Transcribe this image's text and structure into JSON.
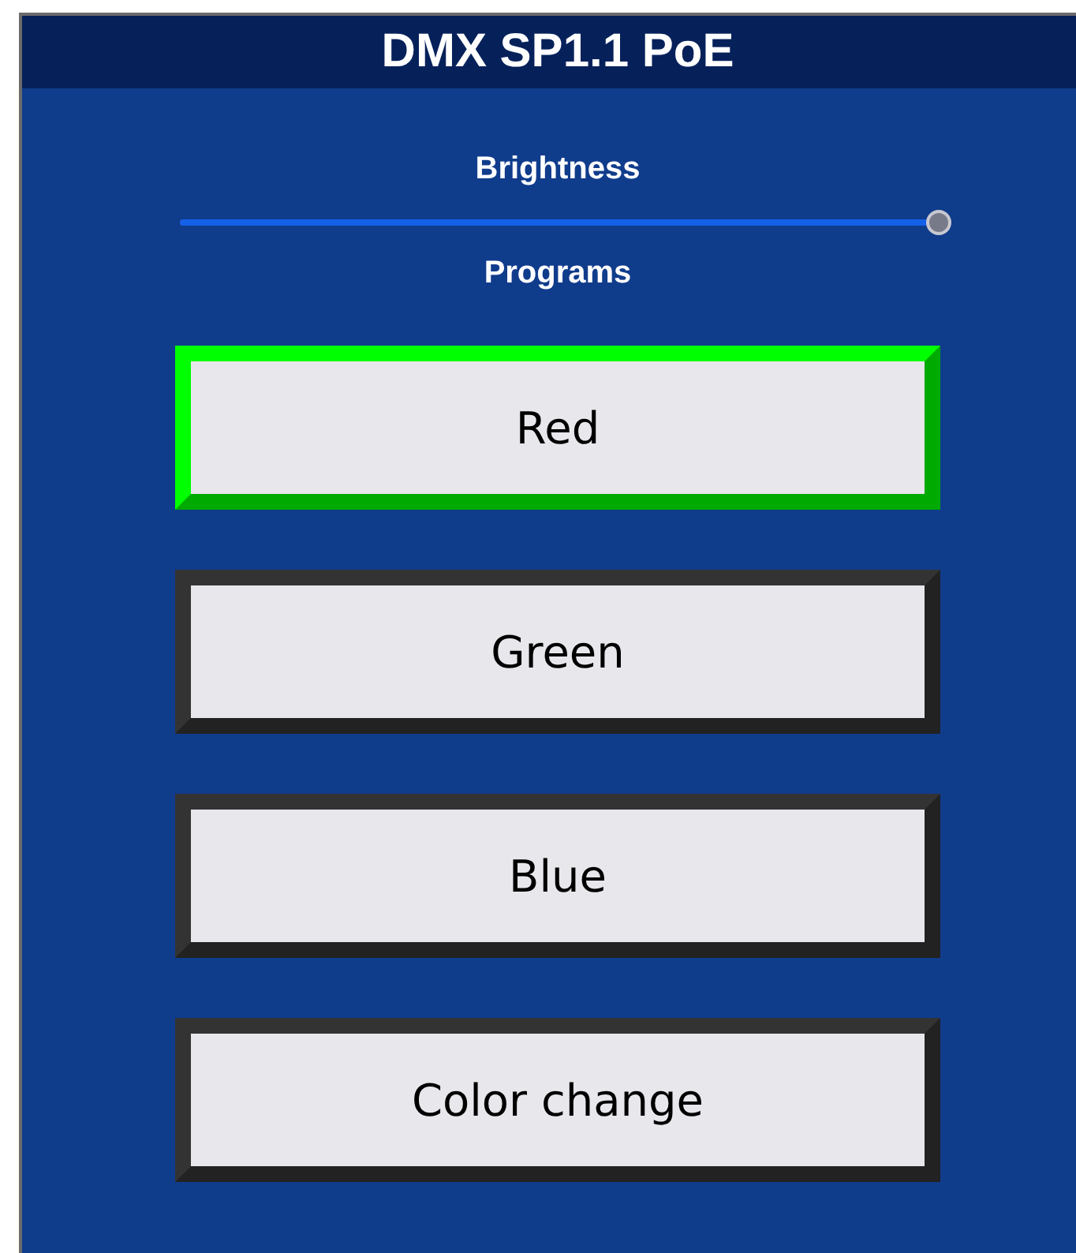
{
  "window": {
    "title": "DMX SP1.1 PoE"
  },
  "brightness": {
    "label": "Brightness",
    "level": 1
  },
  "programs": {
    "label": "Programs",
    "buttons": [
      {
        "label": "Red",
        "selected": true
      },
      {
        "label": "Green",
        "selected": false
      },
      {
        "label": "Blue",
        "selected": false
      },
      {
        "label": "Color change",
        "selected": false
      }
    ]
  }
}
